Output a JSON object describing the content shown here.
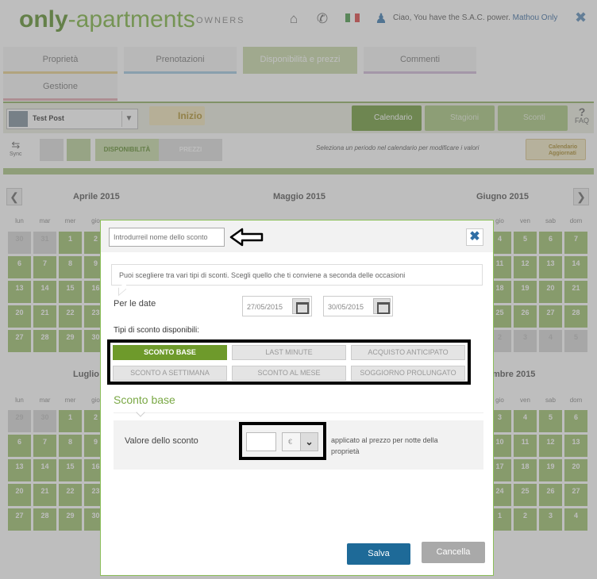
{
  "header": {
    "logo_main": "only",
    "logo_rest": "-apartments",
    "logo_sub": "OWNERS",
    "greeting": "Ciao, You have the S.A.C. power.",
    "user": "Mathou Only"
  },
  "tabs": [
    {
      "label": "Proprietà"
    },
    {
      "label": "Prenotazioni"
    },
    {
      "label": "Disponibilità e prezzi"
    },
    {
      "label": "Commenti"
    },
    {
      "label": "Gestione"
    }
  ],
  "toolbar": {
    "property": "Test Post",
    "inizio": "Inizio",
    "calendario": "Calendario",
    "stagioni": "Stagioni",
    "sconti": "Sconti",
    "faq": "FAQ",
    "sync": "Sync",
    "disponibilita": "DISPONIBILITÀ",
    "prezzi": "PREZZI",
    "hint": "Seleziona un periodo nel calendario per modificare i valori",
    "aggiornati_1": "Calendario",
    "aggiornati_2": "Aggiornati"
  },
  "calendar": {
    "months_row1": [
      "Aprile 2015",
      "Maggio 2015",
      "Giugno 2015"
    ],
    "months_row2": [
      "Luglio",
      "mbre 2015"
    ],
    "dow": [
      "lun",
      "mar",
      "mer",
      "gio"
    ],
    "dow_right": [
      "gio",
      "ven",
      "sab",
      "dom"
    ],
    "left_rows1": [
      [
        "30",
        "31",
        "1",
        "2"
      ],
      [
        "6",
        "7",
        "8",
        "9"
      ],
      [
        "13",
        "14",
        "15",
        "16"
      ],
      [
        "20",
        "21",
        "22",
        "23"
      ],
      [
        "27",
        "28",
        "29",
        "30"
      ]
    ],
    "right_rows1": [
      [
        "4",
        "5",
        "6",
        "7"
      ],
      [
        "11",
        "12",
        "13",
        "14"
      ],
      [
        "18",
        "19",
        "20",
        "21"
      ],
      [
        "25",
        "26",
        "27",
        "28"
      ],
      [
        "2",
        "3",
        "4",
        "5"
      ]
    ],
    "left_rows2": [
      [
        "29",
        "30",
        "1",
        "2"
      ],
      [
        "6",
        "7",
        "8",
        "9"
      ],
      [
        "13",
        "14",
        "15",
        "16"
      ],
      [
        "20",
        "21",
        "22",
        "23"
      ],
      [
        "27",
        "28",
        "29",
        "30"
      ]
    ],
    "right_rows2": [
      [
        "3",
        "4",
        "5",
        "6"
      ],
      [
        "10",
        "11",
        "12",
        "13"
      ],
      [
        "17",
        "18",
        "19",
        "20"
      ],
      [
        "24",
        "25",
        "26",
        "27"
      ],
      [
        "1",
        "2",
        "3",
        "4"
      ]
    ]
  },
  "modal": {
    "name_placeholder": "Introdurreil nome dello sconto",
    "info": "Puoi scegliere tra vari tipi di sconti. Scegli quello che ti conviene a seconda delle occasioni",
    "per_le_date": "Per le date",
    "date_from": "27/05/2015",
    "date_to": "30/05/2015",
    "tipi_label": "Tipi di sconto disponibili:",
    "types": [
      "SCONTO BASE",
      "LAST MINUTE",
      "ACQUISTO ANTICIPATO",
      "SCONTO A SETTIMANA",
      "SCONTO AL MESE",
      "SOGGIORNO PROLUNGATO"
    ],
    "section_title": "Sconto base",
    "valore_label": "Valore dello sconto",
    "currency": "€",
    "applied": "applicato al prezzo per notte della proprietà",
    "save": "Salva",
    "cancel": "Cancella"
  },
  "colors": {
    "brand_green": "#7ab33e",
    "save_blue": "#1e6a98",
    "selected_type": "#6e9a2b"
  }
}
